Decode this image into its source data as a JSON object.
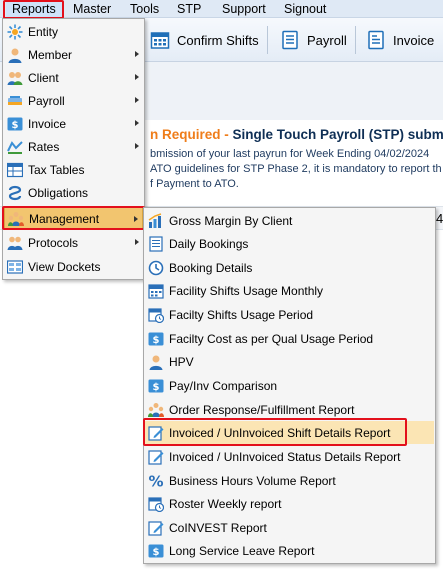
{
  "menubar": {
    "items": [
      {
        "label": "Reports"
      },
      {
        "label": "Master"
      },
      {
        "label": "Tools"
      },
      {
        "label": "STP"
      },
      {
        "label": "Support"
      },
      {
        "label": "Signout"
      }
    ]
  },
  "toolbar": {
    "confirm_shifts": "Confirm Shifts",
    "payroll": "Payroll",
    "invoice": "Invoice"
  },
  "notice": {
    "heading_prefix": "n Required - ",
    "heading": "Single Touch Payroll (STP) submis",
    "line1": "bmission of your last payrun for Week Ending 04/02/2024",
    "line2": " ATO guidelines for STP Phase 2, it is mandatory to report th",
    "line3": "f Payment to ATO.",
    "number": "4"
  },
  "reports_menu": {
    "items": [
      {
        "label": "Entity",
        "icon": "entity-icon",
        "submenu": false
      },
      {
        "label": "Member",
        "icon": "member-icon",
        "submenu": true
      },
      {
        "label": "Client",
        "icon": "client-icon",
        "submenu": true
      },
      {
        "label": "Payroll",
        "icon": "payroll-icon",
        "submenu": true
      },
      {
        "label": "Invoice",
        "icon": "invoice-icon",
        "submenu": true
      },
      {
        "label": "Rates",
        "icon": "rates-icon",
        "submenu": true
      },
      {
        "label": "Tax Tables",
        "icon": "tax-tables-icon",
        "submenu": false
      },
      {
        "label": "Obligations",
        "icon": "obligations-icon",
        "submenu": false
      },
      {
        "label": "Management",
        "icon": "management-icon",
        "submenu": true
      },
      {
        "label": "Protocols",
        "icon": "protocols-icon",
        "submenu": true
      },
      {
        "label": "View Dockets",
        "icon": "view-dockets-icon",
        "submenu": false
      }
    ]
  },
  "management_menu": {
    "items": [
      {
        "label": "Gross Margin By Client"
      },
      {
        "label": "Daily Bookings"
      },
      {
        "label": "Booking Details"
      },
      {
        "label": "Facility Shifts Usage Monthly"
      },
      {
        "label": "Facilty Shifts Usage Period"
      },
      {
        "label": "Facilty Cost as per Qual Usage Period"
      },
      {
        "label": "HPV"
      },
      {
        "label": "Pay/Inv Comparison"
      },
      {
        "label": "Order Response/Fulfillment Report"
      },
      {
        "label": "Invoiced / UnInvoiced Shift Details Report"
      },
      {
        "label": "Invoiced / UnInvoiced Status Details Report"
      },
      {
        "label": "Business Hours Volume Report"
      },
      {
        "label": "Roster Weekly report"
      },
      {
        "label": "CoINVEST Report"
      },
      {
        "label": "Long Service Leave Report"
      }
    ]
  },
  "colors": {
    "highlight_border": "#e3101c",
    "active_item": "#f2c56f",
    "hover_item": "#fbe5b4",
    "menubar": "#dfe9f5"
  }
}
